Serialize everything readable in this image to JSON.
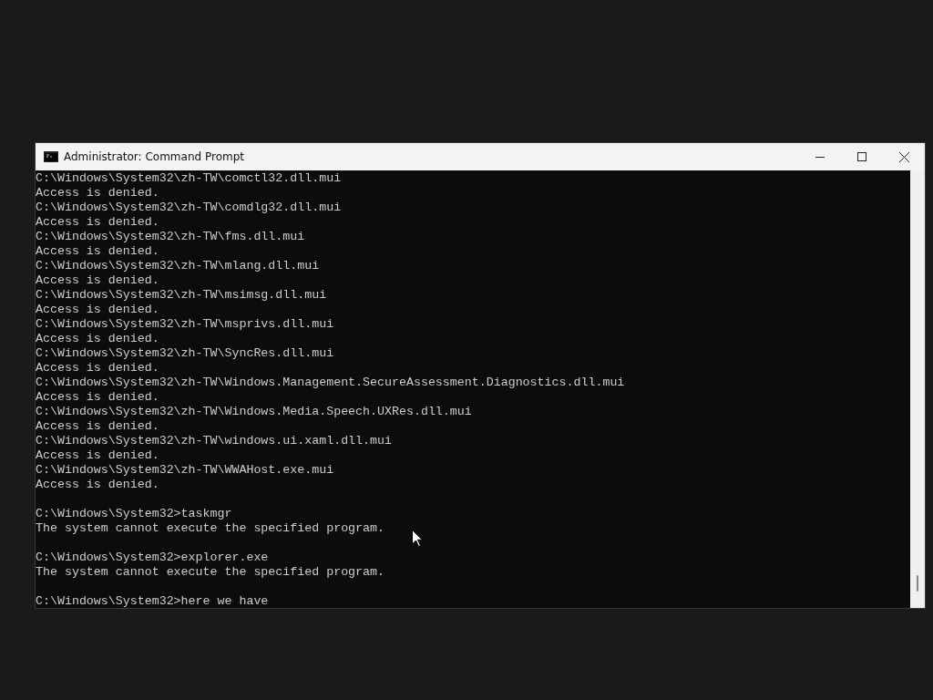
{
  "window": {
    "title": "Administrator: Command Prompt"
  },
  "console": {
    "blocks": [
      [
        "C:\\Windows\\System32\\zh-TW\\comctl32.dll.mui",
        "Access is denied.",
        "C:\\Windows\\System32\\zh-TW\\comdlg32.dll.mui",
        "Access is denied.",
        "C:\\Windows\\System32\\zh-TW\\fms.dll.mui",
        "Access is denied.",
        "C:\\Windows\\System32\\zh-TW\\mlang.dll.mui",
        "Access is denied.",
        "C:\\Windows\\System32\\zh-TW\\msimsg.dll.mui",
        "Access is denied.",
        "C:\\Windows\\System32\\zh-TW\\msprivs.dll.mui",
        "Access is denied.",
        "C:\\Windows\\System32\\zh-TW\\SyncRes.dll.mui",
        "Access is denied.",
        "C:\\Windows\\System32\\zh-TW\\Windows.Management.SecureAssessment.Diagnostics.dll.mui",
        "Access is denied.",
        "C:\\Windows\\System32\\zh-TW\\Windows.Media.Speech.UXRes.dll.mui",
        "Access is denied.",
        "C:\\Windows\\System32\\zh-TW\\windows.ui.xaml.dll.mui",
        "Access is denied.",
        "C:\\Windows\\System32\\zh-TW\\WWAHost.exe.mui",
        "Access is denied."
      ],
      [
        "C:\\Windows\\System32>taskmgr",
        "The system cannot execute the specified program."
      ],
      [
        "C:\\Windows\\System32>explorer.exe",
        "The system cannot execute the specified program."
      ],
      [
        "C:\\Windows\\System32>here we have"
      ]
    ]
  }
}
